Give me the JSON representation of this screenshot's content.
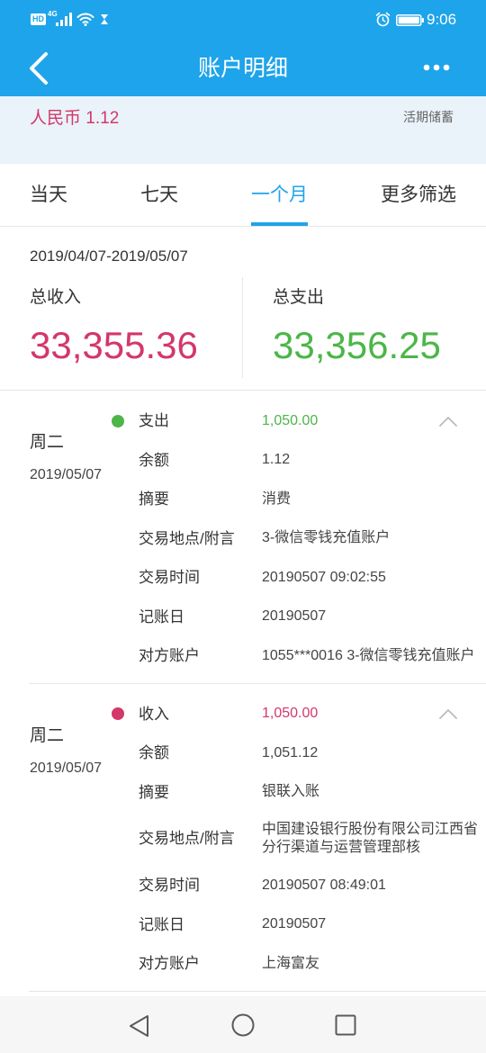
{
  "colors": {
    "brand_blue": "#1ea4ea",
    "account_background": "#e9f3f9",
    "income_red": "#d4376a",
    "expense_green": "#4cb648",
    "text_primary": "#333333",
    "text_secondary": "#666666",
    "divider": "#e6e6e6",
    "nav_bar_background": "#f6f6f6"
  },
  "status_bar": {
    "hd_badge": "HD",
    "network": "4G",
    "time": "9:06",
    "icons": [
      "signal-icon",
      "wifi-icon",
      "hourglass-icon",
      "alarm-icon",
      "battery-icon"
    ]
  },
  "header": {
    "title": "账户明细",
    "icons": [
      "back-arrow-icon",
      "more-icon"
    ]
  },
  "account": {
    "balance": "人民币 1.12",
    "type": "活期储蓄"
  },
  "tabs": {
    "active_index": 2,
    "items": [
      "当天",
      "七天",
      "一个月",
      "更多筛选"
    ]
  },
  "summary": {
    "date_range": "2019/04/07-2019/05/07",
    "income_label": "总收入",
    "income_value": "33,355.36",
    "expense_label": "总支出",
    "expense_value": "33,356.25"
  },
  "transactions": [
    {
      "weekday": "周二",
      "date": "2019/05/07",
      "type_label": "支出",
      "amount": "1,050.00",
      "accent_color": "#4cb648",
      "details": [
        {
          "label": "余额",
          "value": "1.12"
        },
        {
          "label": "摘要",
          "value": "消费"
        },
        {
          "label": "交易地点/附言",
          "value": "3-微信零钱充值账户"
        },
        {
          "label": "交易时间",
          "value": "20190507 09:02:55"
        },
        {
          "label": "记账日",
          "value": "20190507"
        },
        {
          "label": "对方账户",
          "value": "1055***0016 3-微信零钱充值账户"
        }
      ]
    },
    {
      "weekday": "周二",
      "date": "2019/05/07",
      "type_label": "收入",
      "amount": "1,050.00",
      "accent_color": "#d4376a",
      "details": [
        {
          "label": "余额",
          "value": "1,051.12"
        },
        {
          "label": "摘要",
          "value": "银联入账"
        },
        {
          "label": "交易地点/附言",
          "value": "中国建设银行股份有限公司江西省分行渠道与运营管理部核"
        },
        {
          "label": "交易时间",
          "value": "20190507 08:49:01"
        },
        {
          "label": "记账日",
          "value": "20190507"
        },
        {
          "label": "对方账户",
          "value": "上海富友"
        }
      ]
    }
  ],
  "nav_bar": {
    "icons": [
      "nav-back-icon",
      "nav-home-icon",
      "nav-recents-icon"
    ]
  }
}
